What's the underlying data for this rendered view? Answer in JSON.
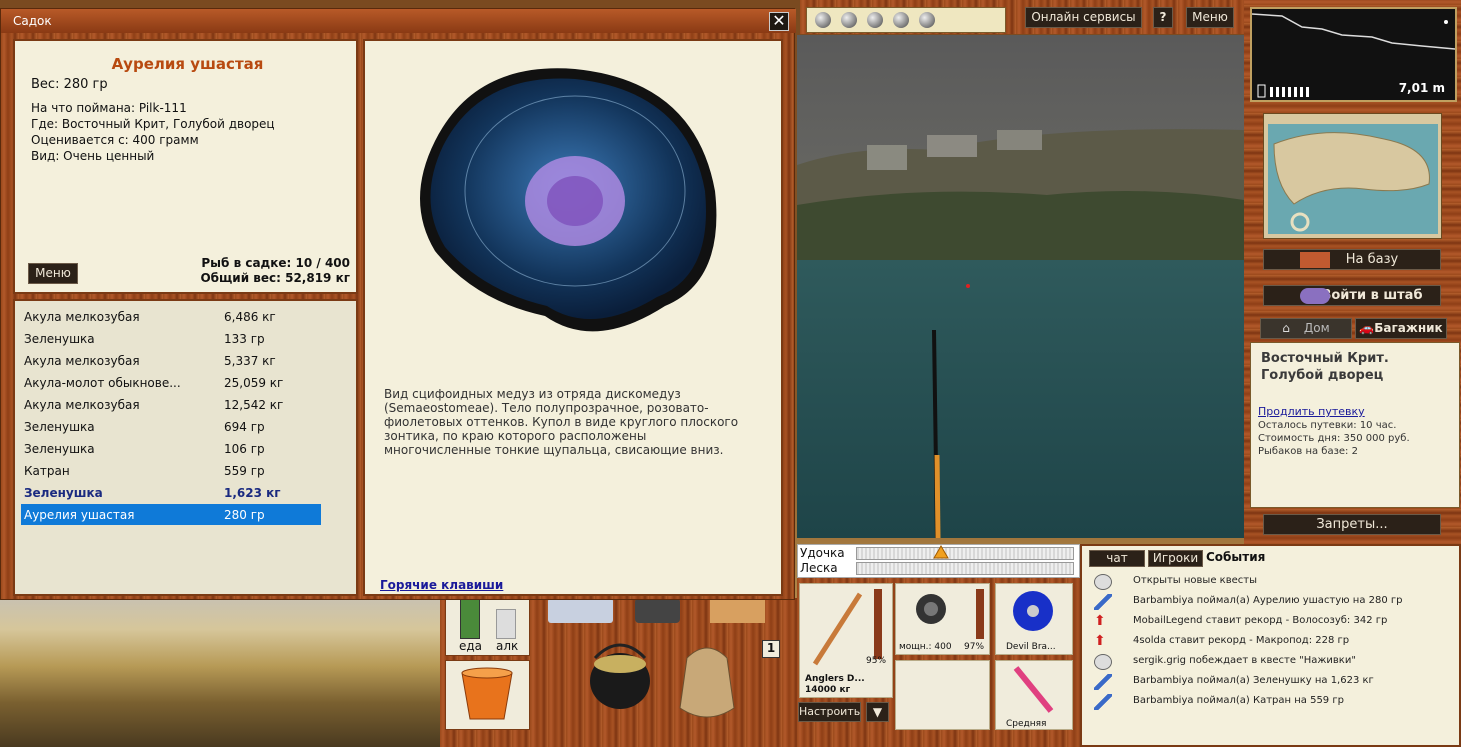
{
  "window": {
    "title": "Садок",
    "close_label": "✕"
  },
  "fish_info": {
    "name": "Аурелия ушастая",
    "weight": "Вес: 280 гр",
    "caught_on": "На что поймана: Pilk-111",
    "where": "Где: Восточный Крит, Голубой дворец",
    "valued_from": "Оценивается с: 400 грамм",
    "kind": "Вид: Очень ценный",
    "menu_button": "Меню",
    "fish_in_keepnet": "Рыб в садке: 10 / 400",
    "total_weight": "Общий вес: 52,819 кг"
  },
  "catch_list": [
    {
      "name": "Акула мелкозубая",
      "weight": "6,486 кг"
    },
    {
      "name": "Зеленушка",
      "weight": "133 гр"
    },
    {
      "name": "Акула мелкозубая",
      "weight": "5,337 кг"
    },
    {
      "name": "Акула-молот обыкнове...",
      "weight": "25,059 кг"
    },
    {
      "name": "Акула мелкозубая",
      "weight": "12,542 кг"
    },
    {
      "name": "Зеленушка",
      "weight": "694 гр"
    },
    {
      "name": "Зеленушка",
      "weight": "106 гр"
    },
    {
      "name": "Катран",
      "weight": "559 гр"
    },
    {
      "name": "Зеленушка",
      "weight": "1,623 кг"
    },
    {
      "name": "Аурелия ушастая",
      "weight": "280 гр"
    }
  ],
  "description": {
    "text": "Вид сцифоидных медуз из отряда дискомедуз (Semaeostomeae). Тело полупрозрачное, розовато-фиолетовых оттенков. Купол в виде круглого плоского зонтика, по краю которого расположены многочисленные тонкие щупальца, свисающие вниз.",
    "hotkeys_link": "Горячие клавиши"
  },
  "topbar": {
    "online_services": "Онлайн сервисы",
    "help": "?",
    "menu": "Меню"
  },
  "sonar": {
    "depth": "7,01 m"
  },
  "right_panel": {
    "to_base": "На базу",
    "enter_hq": "Войти в штаб",
    "tab_home": "Дом",
    "tab_trunk": "Багажник",
    "location_line1": "Восточный Крит.",
    "location_line2": "Голубой дворец",
    "extend_permit": "Продлить путевку",
    "permit_left": "Осталось путевки: 10 час.",
    "day_cost": "Стоимость дня: 350 000 руб.",
    "anglers_on_base": "Рыбаков на базе: 2",
    "bans": "Запреты..."
  },
  "tackle": {
    "rod_label": "Удочка",
    "line_label": "Леска",
    "rod_name": "Anglers D...",
    "rod_capacity": "14000 кг",
    "rod_percent": "95%",
    "reel_power": "мощн.: 400",
    "reel_percent": "97%",
    "line_name": "Devil Bra...",
    "lure_size": "Средняя",
    "setup_button": "Настроить",
    "dropdown": "▼"
  },
  "inventory": {
    "food_label": "еда",
    "alcohol_label": "алк",
    "slot_number": "1"
  },
  "events": {
    "tab_chat": "чат",
    "tab_players": "Игроки",
    "tab_events": "События",
    "rows": [
      {
        "icon": "clock-icon",
        "text": "Открыты новые квесты"
      },
      {
        "icon": "fish-icon",
        "text": "Barbambiya поймал(а) Аурелию ушастую на 280 гр"
      },
      {
        "icon": "record-arrow-icon",
        "text": "MobailLegend ставит рекорд - Волосозуб: 342 гр"
      },
      {
        "icon": "record-arrow-icon",
        "text": "4solda ставит рекорд - Макропод: 228 гр"
      },
      {
        "icon": "clock-icon",
        "text": "sergik.grig побеждает в квесте \"Наживки\""
      },
      {
        "icon": "fish-icon",
        "text": "Barbambiya поймал(а) Зеленушку на 1,623 кг"
      },
      {
        "icon": "fish-icon",
        "text": "Barbambiya поймал(а) Катран на 559 гр"
      }
    ]
  }
}
